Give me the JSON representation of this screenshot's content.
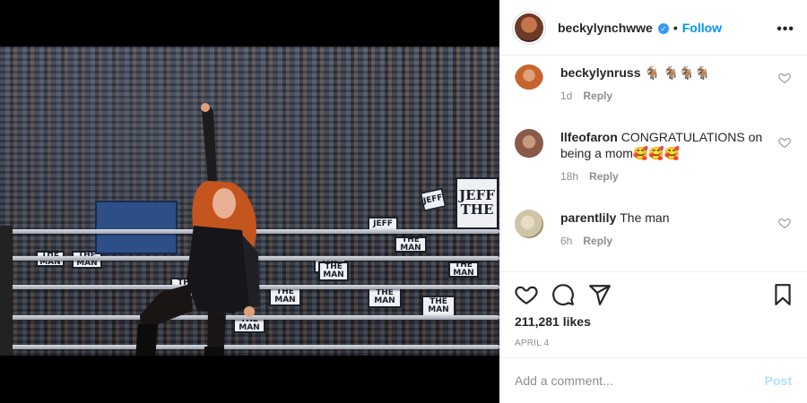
{
  "post": {
    "username": "beckylynchwwe",
    "verified": true,
    "follow_label": "Follow",
    "separator": "•",
    "more_label": "•••"
  },
  "photo": {
    "signs": [
      "JEFF",
      "JEFF",
      "THE MAN",
      "THE MAN",
      "THE MAN",
      "THE MAN",
      "THE MAN",
      "THE MAN",
      "THE MAN",
      "THE MAN",
      "THE MAN",
      "THE MAN",
      "THE MAN"
    ],
    "big_sign": "JEFF\nTHE"
  },
  "comments": [
    {
      "username": "beckylynruss",
      "text": "🐐 🐐🐐🐐",
      "time": "1d",
      "reply": "Reply",
      "avatar_color": "#c7642e"
    },
    {
      "username": "llfeofaron",
      "text": "CONGRATULATIONS on being a mom🥰🥰🥰",
      "time": "18h",
      "reply": "Reply",
      "avatar_color": "#8a5a48"
    },
    {
      "username": "parentlily",
      "text": "The man",
      "time": "6h",
      "reply": "Reply",
      "avatar_color": "#cfc3a8"
    }
  ],
  "actions": {
    "like_icon": "heart-icon",
    "comment_icon": "comment-icon",
    "share_icon": "share-icon",
    "save_icon": "bookmark-icon"
  },
  "likes": "211,281 likes",
  "date": "APRIL 4",
  "add_comment": {
    "placeholder": "Add a comment...",
    "post_label": "Post"
  },
  "colors": {
    "link": "#0095f6",
    "verified": "#3897f0",
    "muted": "#8e8e8e",
    "post_disabled": "#b2dffc"
  }
}
